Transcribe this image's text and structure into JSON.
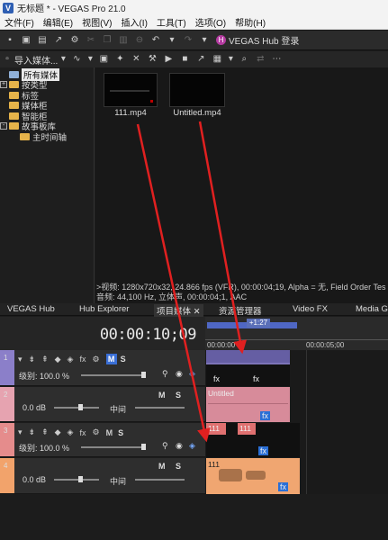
{
  "window": {
    "title": "无标题 * - VEGAS Pro 21.0",
    "logo": "V"
  },
  "menu": [
    "文件(F)",
    "编辑(E)",
    "视图(V)",
    "插入(I)",
    "工具(T)",
    "选项(O)",
    "帮助(H)"
  ],
  "toolbar": {
    "hub_label": "VEGAS Hub 登录"
  },
  "media_toolbar": {
    "import_label": "导入媒体..."
  },
  "tree": [
    {
      "label": "所有媒体",
      "selected": true,
      "expander": "",
      "icon": "grid-folder"
    },
    {
      "label": "按类型",
      "selected": false,
      "expander": "+",
      "icon": "folder"
    },
    {
      "label": "标签",
      "selected": false,
      "expander": "",
      "icon": "folder"
    },
    {
      "label": "媒体柜",
      "selected": false,
      "expander": "",
      "icon": "folder"
    },
    {
      "label": "智能柜",
      "selected": false,
      "expander": "",
      "icon": "folder"
    },
    {
      "label": "故事板库",
      "selected": false,
      "expander": "-",
      "icon": "folder"
    },
    {
      "label": "主时间轴",
      "selected": false,
      "expander": "",
      "icon": "folder"
    }
  ],
  "media_files": [
    {
      "name": "111.mp4"
    },
    {
      "name": "Untitled.mp4"
    }
  ],
  "media_info": {
    "line1": ">视频: 1280x720x32, 24.866 fps (VFR), 00:00:04;19, Alpha = 无, Field Order Tes",
    "line2": "音频: 44,100 Hz, 立体声, 00:00:04;1, AAC"
  },
  "tabs": [
    "VEGAS Hub",
    "Hub Explorer",
    "项目媒体",
    "资源管理器",
    "Video FX",
    "Media Ge"
  ],
  "timeline": {
    "timecode": "00:00:10;09",
    "ruler_marker": "+1:27",
    "ruler_ticks": [
      "00:00:00",
      "00:00:05;00"
    ]
  },
  "tracks": [
    {
      "num": "1",
      "type": "video",
      "level": "级别: 100.0 %",
      "mute": "M",
      "solo": "S",
      "color": "#8b7fc9"
    },
    {
      "num": "2",
      "type": "audio",
      "volume": "0.0 dB",
      "pan": "中间",
      "mute": "M",
      "solo": "S",
      "color": "#e6a3b0"
    },
    {
      "num": "3",
      "type": "video",
      "level": "级别: 100.0 %",
      "mute": "M",
      "solo": "S",
      "color": "#e58c8c"
    },
    {
      "num": "4",
      "type": "audio",
      "volume": "0.0 dB",
      "pan": "中间",
      "mute": "M",
      "solo": "S",
      "color": "#f2a36b"
    }
  ],
  "clips": {
    "track2_title": "Untitled",
    "track3_title": "111",
    "track3_title2": "111",
    "track4_title": "111",
    "fx": "fx"
  },
  "colors": {
    "arrow": "#e02020",
    "loop": "#4f67c4",
    "accent": "#3a6fd6"
  }
}
